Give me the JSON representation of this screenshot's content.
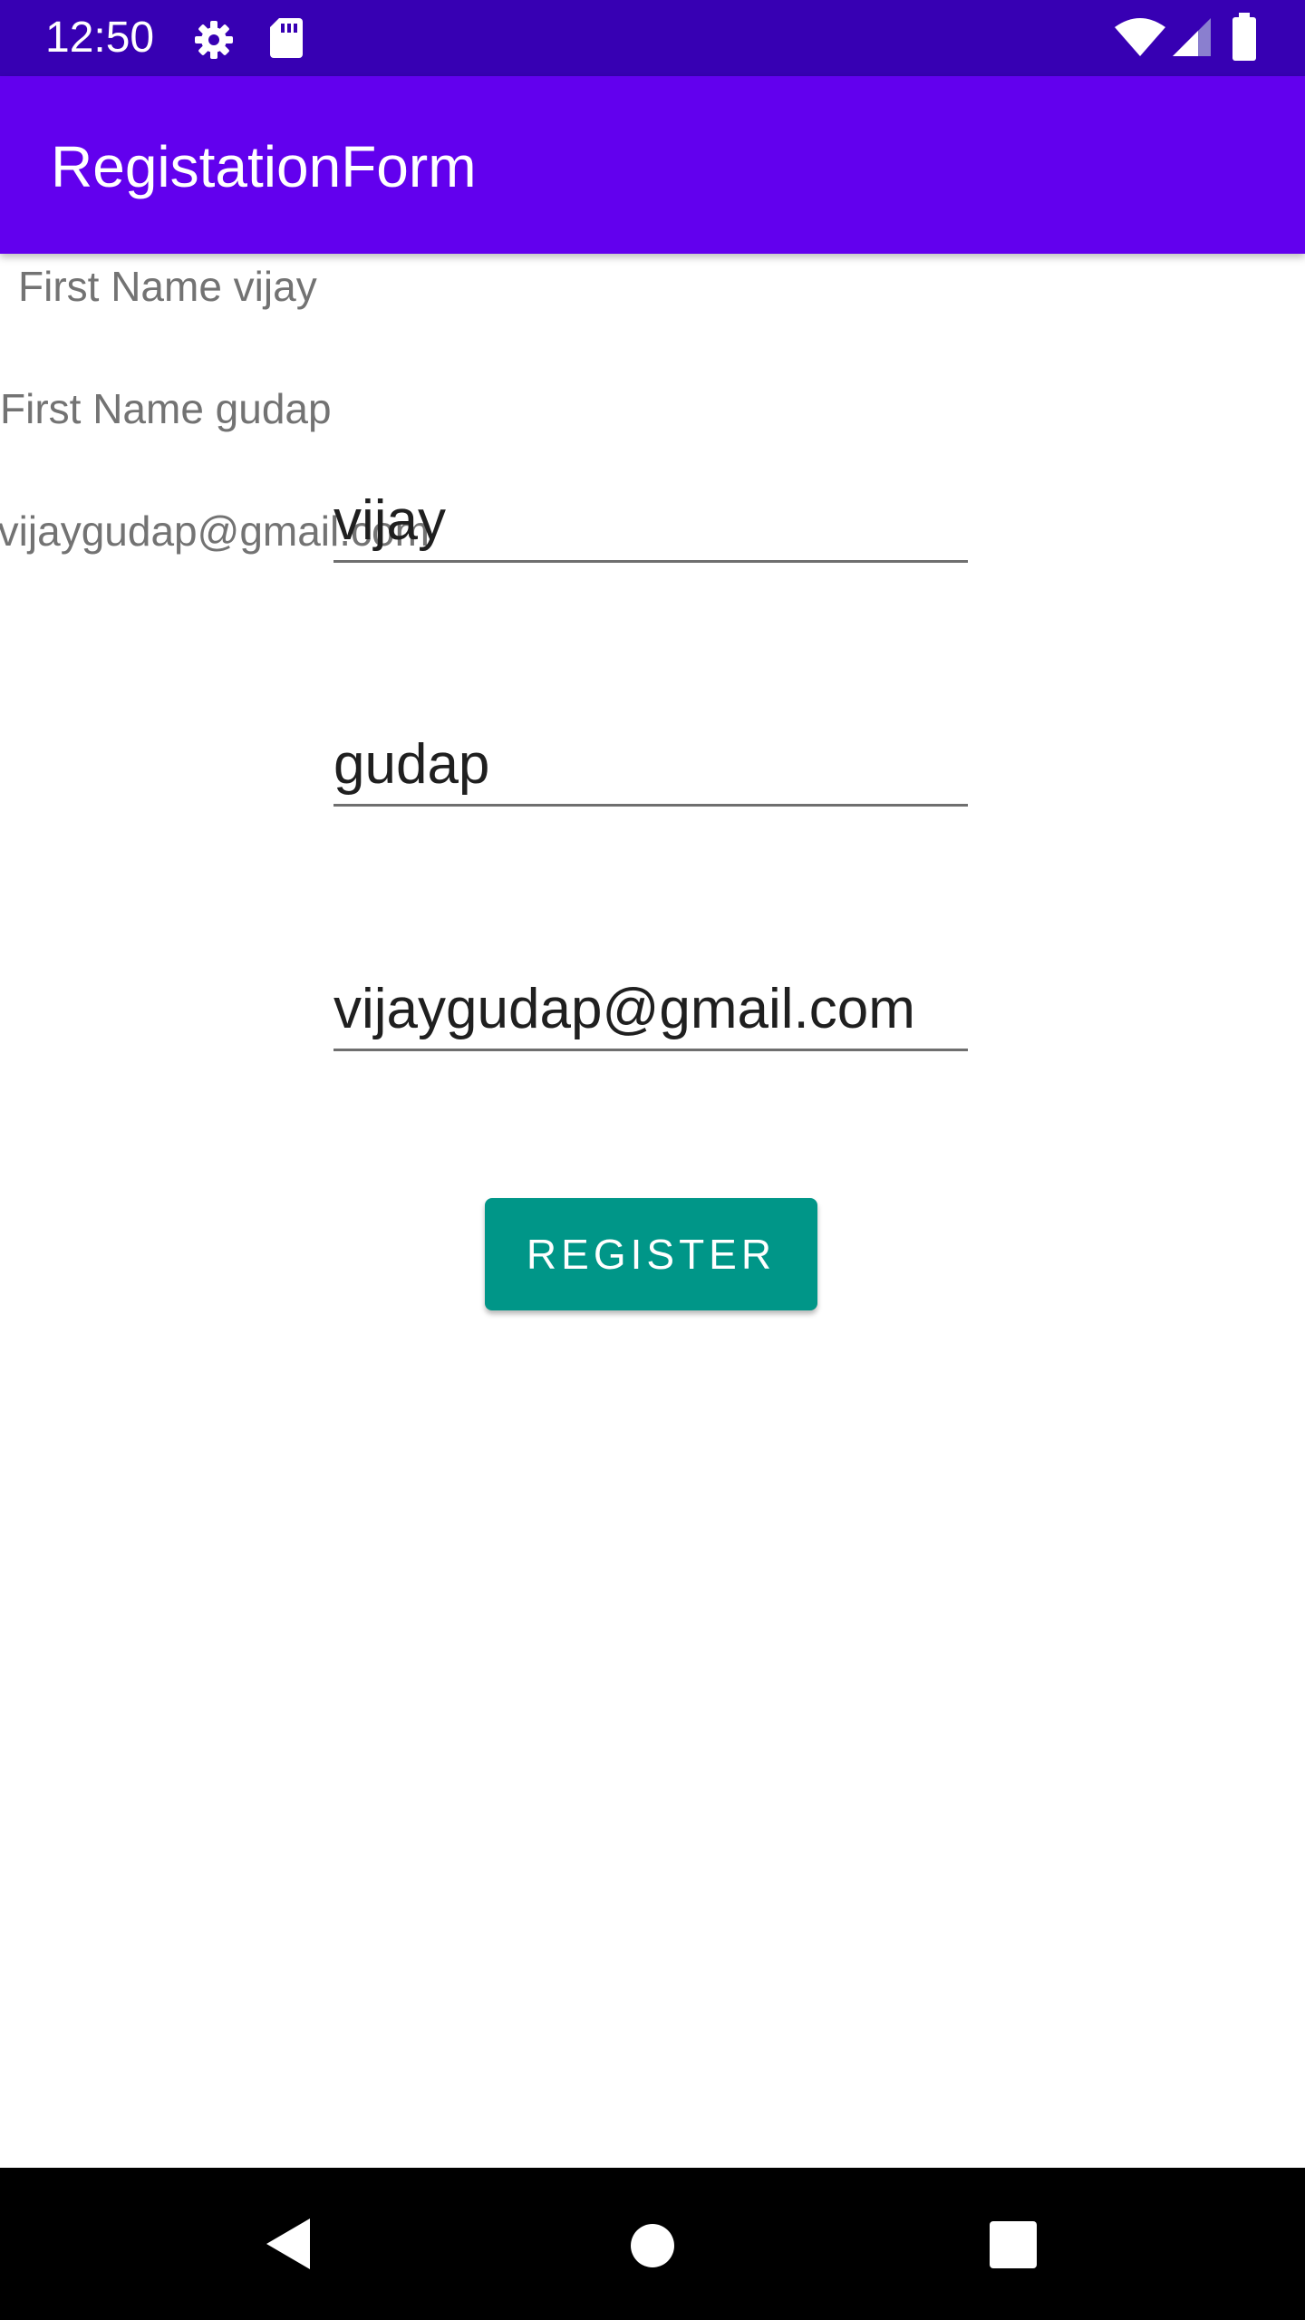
{
  "status_bar": {
    "time": "12:50",
    "icons": [
      "settings-icon",
      "sd-card-icon",
      "wifi-icon",
      "cell-signal-icon",
      "battery-icon"
    ]
  },
  "app_bar": {
    "title": "RegistationForm"
  },
  "display_lines": [
    "First Name vijay",
    "First Name gudap",
    "First Name vijaygudap@gmail.com"
  ],
  "form": {
    "first_name": "vijay",
    "last_name": "gudap",
    "email": "vijaygudap@gmail.com",
    "register_label": "REGISTER"
  },
  "nav_bar": {
    "icons": [
      "back-icon",
      "home-icon",
      "recents-icon"
    ]
  },
  "colors": {
    "status_bar": "#3700b3",
    "app_bar": "#6200ee",
    "button": "#009688",
    "nav_bar": "#000000"
  }
}
